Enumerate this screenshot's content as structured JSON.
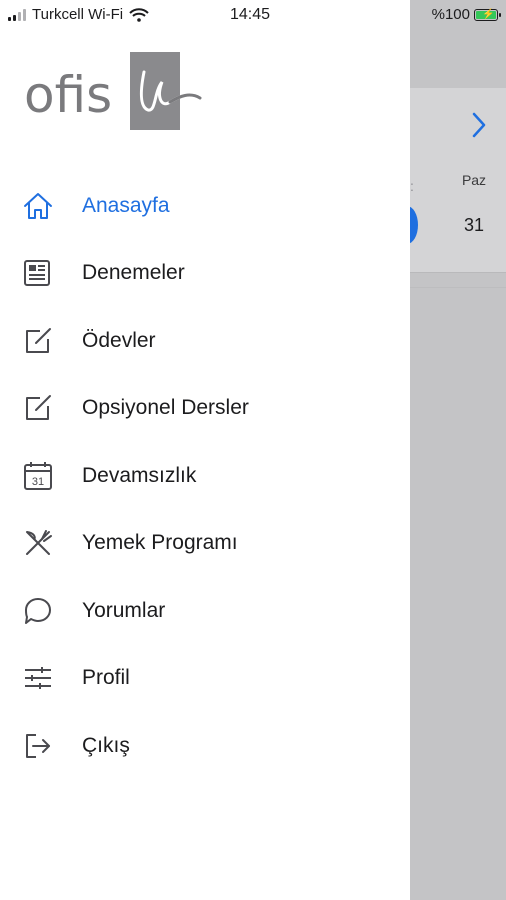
{
  "status_bar": {
    "carrier": "Turkcell Wi-Fi",
    "time": "14:45",
    "battery": "%100"
  },
  "drawer": {
    "logo_text": "ofis",
    "menu": [
      {
        "label": "Anasayfa",
        "icon": "home-icon",
        "active": true
      },
      {
        "label": "Denemeler",
        "icon": "newspaper-icon",
        "active": false
      },
      {
        "label": "Ödevler",
        "icon": "edit-icon",
        "active": false
      },
      {
        "label": "Opsiyonel Dersler",
        "icon": "edit-icon",
        "active": false
      },
      {
        "label": "Devamsızlık",
        "icon": "calendar-icon",
        "active": false
      },
      {
        "label": "Yemek Programı",
        "icon": "utensils-icon",
        "active": false
      },
      {
        "label": "Yorumlar",
        "icon": "chat-bubble-icon",
        "active": false
      },
      {
        "label": "Profil",
        "icon": "sliders-icon",
        "active": false
      },
      {
        "label": "Çıkış",
        "icon": "logout-icon",
        "active": false
      }
    ]
  },
  "background": {
    "day_header": "Paz",
    "date": "31"
  },
  "colors": {
    "accent": "#1f6fe0",
    "text": "#1c1c1e",
    "icon": "#4a4a4f",
    "overlay": "#c4c4c6"
  }
}
